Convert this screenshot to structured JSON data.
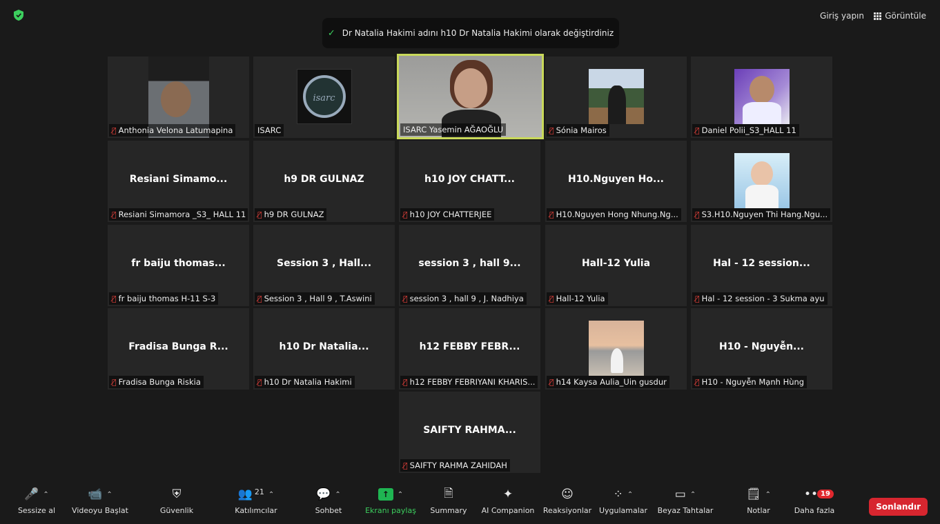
{
  "topbar": {
    "shield_icon": "shield-check-icon",
    "signin_label": "Giriş yapın",
    "view_label": "Görüntüle"
  },
  "toast": {
    "message": "Dr Natalia Hakimi adını h10 Dr Natalia Hakimi olarak değiştirdiniz"
  },
  "tiles": [
    {
      "label": "Anthonia Velona Latumapina",
      "display": ""
    },
    {
      "label": "ISARC",
      "display": "",
      "logo_text": "isarc"
    },
    {
      "label": "ISARC Yasemin AĞAOĞLU",
      "display": ""
    },
    {
      "label": "Sónia Mairos",
      "display": ""
    },
    {
      "label": "Daniel Polii_S3_HALL 11",
      "display": ""
    },
    {
      "label": "Resiani Simamora _S3_ HALL 11",
      "display": "Resiani Simamo..."
    },
    {
      "label": "h9 DR GULNAZ",
      "display": "h9 DR GULNAZ"
    },
    {
      "label": "h10 JOY CHATTERJEE",
      "display": "h10 JOY CHATT..."
    },
    {
      "label": "H10.Nguyen Hong Nhung.Ng...",
      "display": "H10.Nguyen Ho..."
    },
    {
      "label": "S3.H10.Nguyen Thi Hang.Ngu...",
      "display": ""
    },
    {
      "label": "fr baiju thomas H-11 S-3",
      "display": "fr baiju thomas..."
    },
    {
      "label": "Session 3 , Hall 9 , T.Aswini",
      "display": "Session 3 , Hall..."
    },
    {
      "label": "session 3 , hall 9 , J. Nadhiya",
      "display": "session 3 , hall 9..."
    },
    {
      "label": "Hall-12 Yulia",
      "display": "Hall-12 Yulia"
    },
    {
      "label": "Hal - 12 session - 3 Sukma ayu",
      "display": "Hal - 12 session..."
    },
    {
      "label": "Fradisa Bunga Riskia",
      "display": "Fradisa Bunga R..."
    },
    {
      "label": "h10 Dr Natalia Hakimi",
      "display": "h10 Dr Natalia..."
    },
    {
      "label": "h12 FEBBY FEBRIYANI KHARIS...",
      "display": "h12 FEBBY FEBR..."
    },
    {
      "label": "h14 Kaysa Aulia_Uin gusdur",
      "display": ""
    },
    {
      "label": "H10 - Nguyễn Mạnh Hùng",
      "display": "H10 - Nguyễn..."
    },
    {
      "label": "SAIFTY RAHMA ZAHIDAH",
      "display": "SAIFTY RAHMA..."
    }
  ],
  "toolbar": {
    "mute_label": "Sessize al",
    "video_label": "Videoyu Başlat",
    "security_label": "Güvenlik",
    "participants_label": "Katılımcılar",
    "participants_count": "21",
    "chat_label": "Sohbet",
    "share_label": "Ekranı paylaş",
    "summary_label": "Summary",
    "ai_label": "AI Companion",
    "reactions_label": "Reaksiyonlar",
    "apps_label": "Uygulamalar",
    "whiteboard_label": "Beyaz Tahtalar",
    "notes_label": "Notlar",
    "more_label": "Daha fazla",
    "more_badge": "19",
    "end_label": "Sonlandır"
  },
  "colors": {
    "accent_green": "#3ccf5e",
    "active_speaker_border": "#c9d95a",
    "end_red": "#d7262f",
    "mic_muted_red": "#e0403a"
  }
}
